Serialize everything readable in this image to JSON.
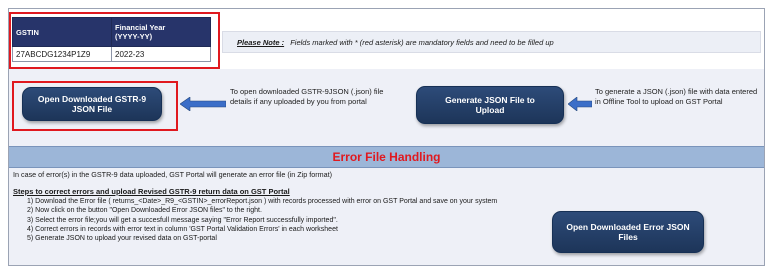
{
  "gstin_table": {
    "headers": [
      "GSTIN",
      "Financial Year\n(YYYY-YY)"
    ],
    "values": [
      "27ABCDG1234P1Z9",
      "2022-23"
    ]
  },
  "note": {
    "label": "Please Note :",
    "text": "Fields marked with  *  (red asterisk) are mandatory fields and need to be filled up"
  },
  "buttons": {
    "open_gstr9": "Open Downloaded GSTR-9 JSON File",
    "generate_json": "Generate JSON File to Upload",
    "open_error": "Open Downloaded Error JSON Files"
  },
  "info": {
    "open_gstr9_desc": "To open downloaded GSTR-9JSON (.json) file details if any uploaded by you from portal",
    "generate_desc": "To generate a JSON (.json) file with data entered in Offline Tool to upload on GST Portal"
  },
  "error_section": {
    "title": "Error File Handling",
    "intro": "In case of error(s) in the GSTR-9 data uploaded, GST Portal will generate an error file (in  Zip format)",
    "steps_title": "Steps to correct errors and upload Revised GSTR-9 return data on GST Portal",
    "steps": [
      "1) Download the Error file  ( returns_<Date>_R9_<GSTIN>_errorReport.json ) with records processed with error on GST Portal and save on your system",
      "2) Now click on the button \"Open Downloaded Error JSON files\" to the right.",
      "3) Select the error file;you will get a succesfull message saying \"Error Report successfully imported\".",
      "4) Correct errors in records with error text in column 'GST Portal Validation Errors' in each worksheet",
      "5) Generate JSON to upload your revised data on GST-portal"
    ]
  },
  "colors": {
    "header_navy": "#27346a",
    "button_navy": "#1d3559",
    "highlight_red": "#e0191f",
    "section_band": "#9cb6d8"
  }
}
